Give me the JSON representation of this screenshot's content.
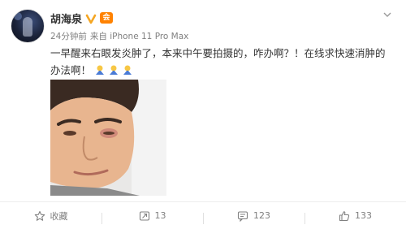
{
  "post": {
    "author": "胡海泉",
    "member_badge": "会",
    "time": "24分钟前",
    "source": "来自 iPhone 11 Pro Max",
    "text": "一早醒来右眼发炎肿了，本来中午要拍摄的，咋办啊？！在线求快速消肿的办法啊！",
    "emojis": [
      "pray-emoji",
      "pray-emoji",
      "pray-emoji"
    ]
  },
  "actions": {
    "favorite_label": "收藏",
    "repost_count": "13",
    "comment_count": "123",
    "like_count": "133"
  },
  "colors": {
    "verified": "#f5a623",
    "member": "#ff8200",
    "meta_text": "#808080"
  }
}
